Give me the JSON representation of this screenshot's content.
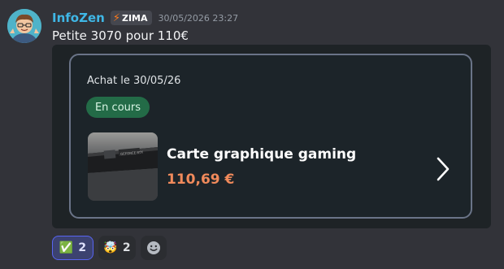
{
  "author": {
    "username": "InfoZen",
    "tag": "ZIMA",
    "timestamp": "30/05/2026 23:27"
  },
  "message": {
    "text": "Petite 3070 pour 110€"
  },
  "embed": {
    "purchase_date": "Achat le 30/05/26",
    "status": "En cours",
    "product_name": "Carte graphique gaming",
    "price": "110,69 €",
    "thumbnail_caption": "GEFORCE RTX"
  },
  "reactions": [
    {
      "emoji": "✅",
      "count": "2",
      "active": true
    },
    {
      "emoji": "🤯",
      "count": "2",
      "active": false
    }
  ],
  "colors": {
    "username": "#3fb7e6",
    "status_badge": "#236b47",
    "price": "#f08a5b",
    "active_reaction_border": "#5865f2"
  },
  "icons": {
    "tag": "lightning-bolt-icon",
    "chevron": "chevron-right-icon",
    "add_reaction": "add-reaction-icon"
  }
}
